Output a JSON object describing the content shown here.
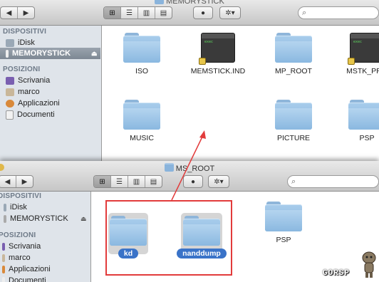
{
  "window_top": {
    "title": "MEMORYSTICK",
    "search_placeholder": "",
    "sidebar": {
      "devices_header": "DISPOSITIVI",
      "devices": [
        "iDisk",
        "MEMORYSTICK"
      ],
      "places_header": "POSIZIONI",
      "places": [
        "Scrivania",
        "marco",
        "Applicazioni",
        "Documenti"
      ]
    },
    "files": [
      "ISO",
      "MEMSTICK.IND",
      "MP_ROOT",
      "MSTK_PRO",
      "MUSIC",
      "PICTURE",
      "PSP"
    ]
  },
  "window_bottom": {
    "title": "MS_ROOT",
    "sidebar": {
      "devices_header": "DISPOSITIVI",
      "devices": [
        "iDisk",
        "MEMORYSTICK"
      ],
      "places_header": "POSIZIONI",
      "places": [
        "Scrivania",
        "marco",
        "Applicazioni",
        "Documenti"
      ]
    },
    "files": [
      "kd",
      "nanddump",
      "PSP"
    ]
  },
  "toolbar": {
    "back_icon": "◀",
    "forward_icon": "▶",
    "eye_icon": "●",
    "gear_icon": "✲",
    "eject_icon": "⏏",
    "search_icon": "⌕"
  },
  "watermark": "GORSP",
  "colors": {
    "accent": "#3a73c8",
    "highlight_box": "#e23b3b",
    "sidebar_bg": "#dfe4ea"
  }
}
